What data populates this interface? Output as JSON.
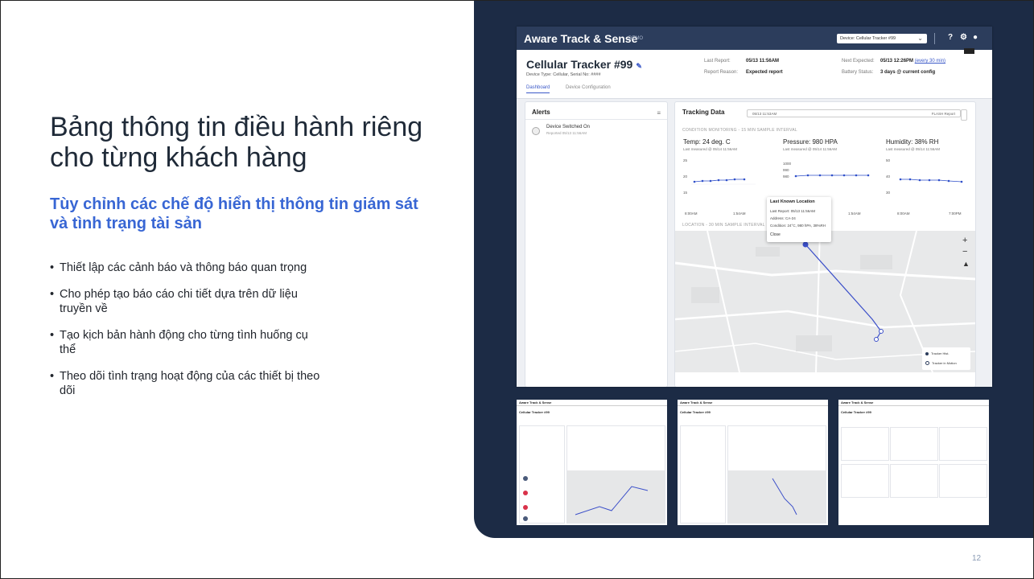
{
  "slide": {
    "title": "Bảng thông tin điều hành riêng cho từng khách hàng",
    "subtitle": "Tùy chỉnh các chế độ hiển thị thông tin giám sát và tình trạng tài sản",
    "bullets": [
      "Thiết lập các cảnh báo và thông báo quan trọng",
      "Cho phép tạo báo cáo chi tiết dựa trên dữ liệu truyền về",
      "Tạo kịch bản hành động cho từng tình huống cụ thể",
      "Theo dõi tình trạng hoạt động của các thiết bị theo dõi"
    ],
    "bullet_glyph": "•",
    "page_number": "12",
    "colors": {
      "panel": "#1c2b45",
      "subtitle": "#3866d4",
      "app_bar": "#2c3d5c",
      "accent": "#3b59c8"
    }
  },
  "app": {
    "brand": "Aware Track & Sense",
    "brand_tag": "DEMO",
    "device_select": "Device: Cellular Tracker #99",
    "chevron": "⌄",
    "icons": {
      "help": "?",
      "settings": "⚙",
      "user": "●"
    },
    "device": {
      "name": "Cellular Tracker #99",
      "edit_icon": "✎",
      "subtitle": "Device Type: Cellular, Serial No: ####",
      "last_report_label": "Last Report:",
      "last_report_value": "05/13 11:56AM",
      "report_reason_label": "Report Reason:",
      "report_reason_value": "Expected report",
      "next_expected_label": "Next Expected:",
      "next_expected_value": "05/13 12:26PM",
      "next_expected_link": "(every 30 min)",
      "battery_label": "Battery Status:",
      "battery_value": "3 days @ current config"
    },
    "tabs": [
      "Dashboard",
      "Device Configuration"
    ],
    "alerts": {
      "title": "Alerts",
      "filter_icon": "≡",
      "items": [
        {
          "text": "Device Switched On",
          "date": "Reported 05/13 11:56AM"
        }
      ]
    },
    "tracking": {
      "title": "Tracking Data",
      "date_start": "05/13 11:53AM",
      "date_end": "FLASH Report",
      "condition_label": "CONDITION MONITORING - 15 MIN SAMPLE INTERVAL",
      "metrics": [
        {
          "label": "Temp: 24 deg. C",
          "measured": "Last measured @ 05/14 11:56AM",
          "ticks": [
            "25",
            "20",
            "15"
          ],
          "x_ticks": [
            "8:00AM",
            "1:54AM"
          ]
        },
        {
          "label": "Pressure: 980 HPA",
          "measured": "Last measured @ 05/14 11:56AM",
          "ticks": [
            "1000",
            "990",
            "980"
          ],
          "x_ticks": [
            "8:00AM",
            "1:54AM"
          ]
        },
        {
          "label": "Humidity: 38% RH",
          "measured": "Last measured @ 05/14 11:56AM",
          "ticks": [
            "50",
            "40",
            "30"
          ],
          "x_ticks": [
            "8:00AM",
            "7:00PM"
          ]
        }
      ],
      "popup": {
        "title": "Last Known Location",
        "rows": [
          {
            "label": "Last Report:",
            "value": "05/13 11:56AM"
          },
          {
            "label": "Address:",
            "value": "CA-24"
          },
          {
            "label": "Condition:",
            "value": "24°C, 980 hPA, 38%RH"
          }
        ],
        "close": "Close"
      },
      "location_label": "LOCATION - 30 MIN SAMPLE INTERVAL",
      "map_controls": [
        "+",
        "−",
        "▲"
      ],
      "legend": [
        "Tracker Hist.",
        "Tracker in Motion"
      ]
    }
  },
  "thumbnails": [
    {
      "brand": "Aware Track & Sense",
      "title": "Cellular Tracker #99"
    },
    {
      "brand": "Aware Track & Sense",
      "title": "Cellular Tracker #99"
    },
    {
      "brand": "Aware Track & Sense",
      "title": "Cellular Tracker #99"
    }
  ]
}
